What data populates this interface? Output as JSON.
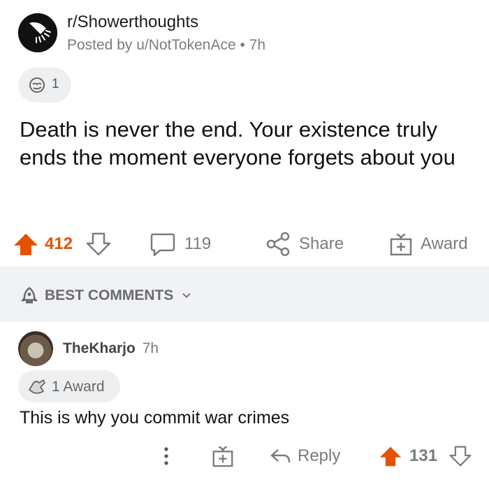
{
  "post": {
    "subreddit": "r/Showerthoughts",
    "posted_by": "Posted by u/NotTokenAce",
    "separator": "•",
    "age": "7h",
    "award_count": "1",
    "title": "Death is never the end. Your existence truly ends the moment everyone forgets about you",
    "upvotes": "412",
    "comments": "119",
    "share_label": "Share",
    "award_label": "Award"
  },
  "comments_header": {
    "sort_label": "BEST COMMENTS"
  },
  "comment": {
    "author": "TheKharjo",
    "age": "7h",
    "award_label": "1 Award",
    "body": "This is why you commit war crimes",
    "reply_label": "Reply",
    "score": "131"
  },
  "colors": {
    "upvote": "#e65100",
    "muted": "#787c7e",
    "band": "#f1f2f4"
  }
}
